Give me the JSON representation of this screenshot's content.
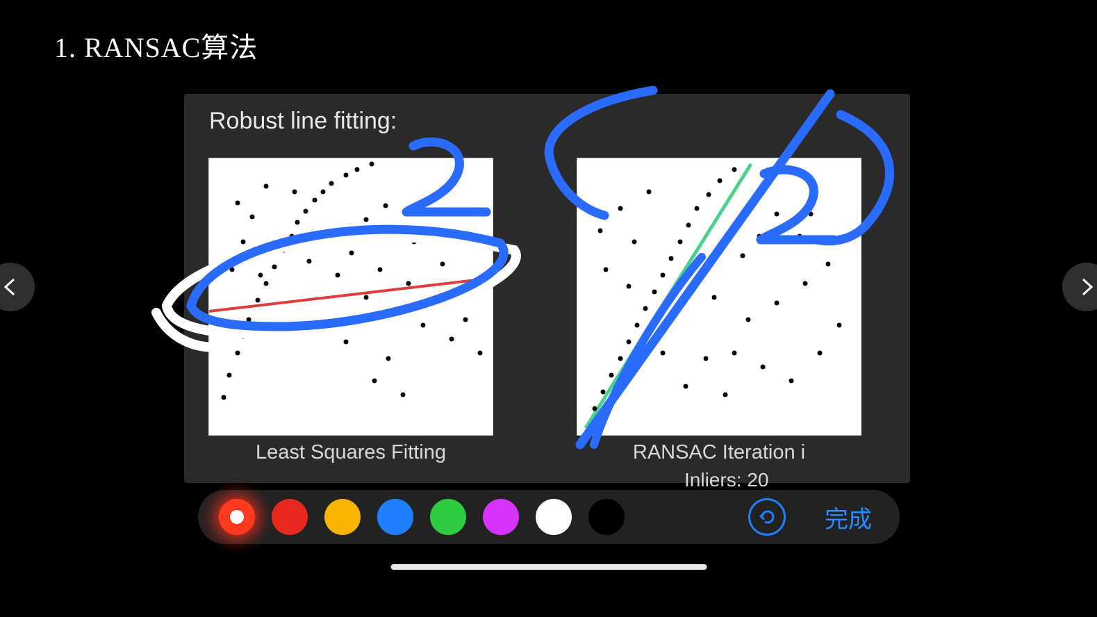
{
  "slide": {
    "title": "1. RANSAC算法"
  },
  "card": {
    "heading": "Robust line fitting:",
    "left_caption": "Least Squares Fitting",
    "right_caption": "RANSAC Iteration i",
    "inliers_label": "Inliers: 20"
  },
  "chart_data": [
    {
      "type": "scatter",
      "title": "Least Squares Fitting",
      "xlabel": "",
      "ylabel": "",
      "xlim": [
        0,
        1
      ],
      "ylim": [
        0,
        1
      ],
      "points": [
        [
          0.05,
          0.14
        ],
        [
          0.07,
          0.22
        ],
        [
          0.1,
          0.3
        ],
        [
          0.12,
          0.36
        ],
        [
          0.14,
          0.42
        ],
        [
          0.17,
          0.49
        ],
        [
          0.2,
          0.55
        ],
        [
          0.23,
          0.61
        ],
        [
          0.26,
          0.67
        ],
        [
          0.29,
          0.72
        ],
        [
          0.31,
          0.77
        ],
        [
          0.34,
          0.81
        ],
        [
          0.37,
          0.85
        ],
        [
          0.4,
          0.88
        ],
        [
          0.43,
          0.91
        ],
        [
          0.48,
          0.94
        ],
        [
          0.52,
          0.96
        ],
        [
          0.57,
          0.98
        ],
        [
          0.1,
          0.84
        ],
        [
          0.15,
          0.79
        ],
        [
          0.2,
          0.9
        ],
        [
          0.25,
          0.7
        ],
        [
          0.3,
          0.88
        ],
        [
          0.35,
          0.63
        ],
        [
          0.4,
          0.72
        ],
        [
          0.45,
          0.58
        ],
        [
          0.5,
          0.66
        ],
        [
          0.55,
          0.5
        ],
        [
          0.6,
          0.6
        ],
        [
          0.65,
          0.45
        ],
        [
          0.7,
          0.55
        ],
        [
          0.75,
          0.4
        ],
        [
          0.8,
          0.48
        ],
        [
          0.85,
          0.35
        ],
        [
          0.9,
          0.42
        ],
        [
          0.95,
          0.3
        ],
        [
          0.58,
          0.2
        ],
        [
          0.63,
          0.28
        ],
        [
          0.68,
          0.15
        ],
        [
          0.08,
          0.6
        ],
        [
          0.12,
          0.7
        ],
        [
          0.18,
          0.58
        ],
        [
          0.42,
          0.4
        ],
        [
          0.48,
          0.34
        ],
        [
          0.55,
          0.78
        ],
        [
          0.62,
          0.83
        ],
        [
          0.72,
          0.7
        ],
        [
          0.82,
          0.62
        ]
      ],
      "fit_line": {
        "color": "#e23b3b",
        "points": [
          [
            0.0,
            0.45
          ],
          [
            1.0,
            0.57
          ]
        ]
      }
    },
    {
      "type": "scatter",
      "title": "RANSAC Iteration i",
      "xlabel": "",
      "ylabel": "",
      "xlim": [
        0,
        1
      ],
      "ylim": [
        0,
        1
      ],
      "points": [
        [
          0.06,
          0.1
        ],
        [
          0.09,
          0.16
        ],
        [
          0.12,
          0.22
        ],
        [
          0.15,
          0.28
        ],
        [
          0.18,
          0.34
        ],
        [
          0.21,
          0.4
        ],
        [
          0.24,
          0.46
        ],
        [
          0.27,
          0.52
        ],
        [
          0.3,
          0.58
        ],
        [
          0.33,
          0.64
        ],
        [
          0.36,
          0.7
        ],
        [
          0.39,
          0.76
        ],
        [
          0.42,
          0.82
        ],
        [
          0.46,
          0.87
        ],
        [
          0.5,
          0.92
        ],
        [
          0.55,
          0.96
        ],
        [
          0.15,
          0.82
        ],
        [
          0.2,
          0.7
        ],
        [
          0.25,
          0.88
        ],
        [
          0.1,
          0.6
        ],
        [
          0.08,
          0.74
        ],
        [
          0.18,
          0.54
        ],
        [
          0.55,
          0.3
        ],
        [
          0.6,
          0.42
        ],
        [
          0.65,
          0.25
        ],
        [
          0.7,
          0.48
        ],
        [
          0.75,
          0.2
        ],
        [
          0.8,
          0.55
        ],
        [
          0.85,
          0.3
        ],
        [
          0.88,
          0.62
        ],
        [
          0.92,
          0.4
        ],
        [
          0.58,
          0.65
        ],
        [
          0.64,
          0.72
        ],
        [
          0.7,
          0.8
        ],
        [
          0.52,
          0.15
        ],
        [
          0.45,
          0.28
        ],
        [
          0.38,
          0.18
        ],
        [
          0.3,
          0.3
        ],
        [
          0.48,
          0.5
        ],
        [
          0.78,
          0.72
        ],
        [
          0.82,
          0.8
        ],
        [
          0.9,
          0.7
        ]
      ],
      "fit_line": {
        "color": "#4bd28a",
        "points": [
          [
            0.03,
            0.03
          ],
          [
            0.61,
            0.98
          ]
        ]
      }
    }
  ],
  "toolbar": {
    "colors": [
      {
        "id": "active-red",
        "hex": "#ff3a1f",
        "active": true
      },
      {
        "id": "red",
        "hex": "#e8281d"
      },
      {
        "id": "orange",
        "hex": "#f7b500"
      },
      {
        "id": "blue",
        "hex": "#1e7fff",
        "outlined": true
      },
      {
        "id": "green",
        "hex": "#2ecc40"
      },
      {
        "id": "magenta",
        "hex": "#d633ff"
      },
      {
        "id": "white",
        "hex": "#ffffff"
      },
      {
        "id": "black",
        "hex": "#000000"
      }
    ],
    "done_label": "完成"
  },
  "annotations": {
    "stroke": "#2a6bff",
    "white_stroke": "#ffffff"
  }
}
